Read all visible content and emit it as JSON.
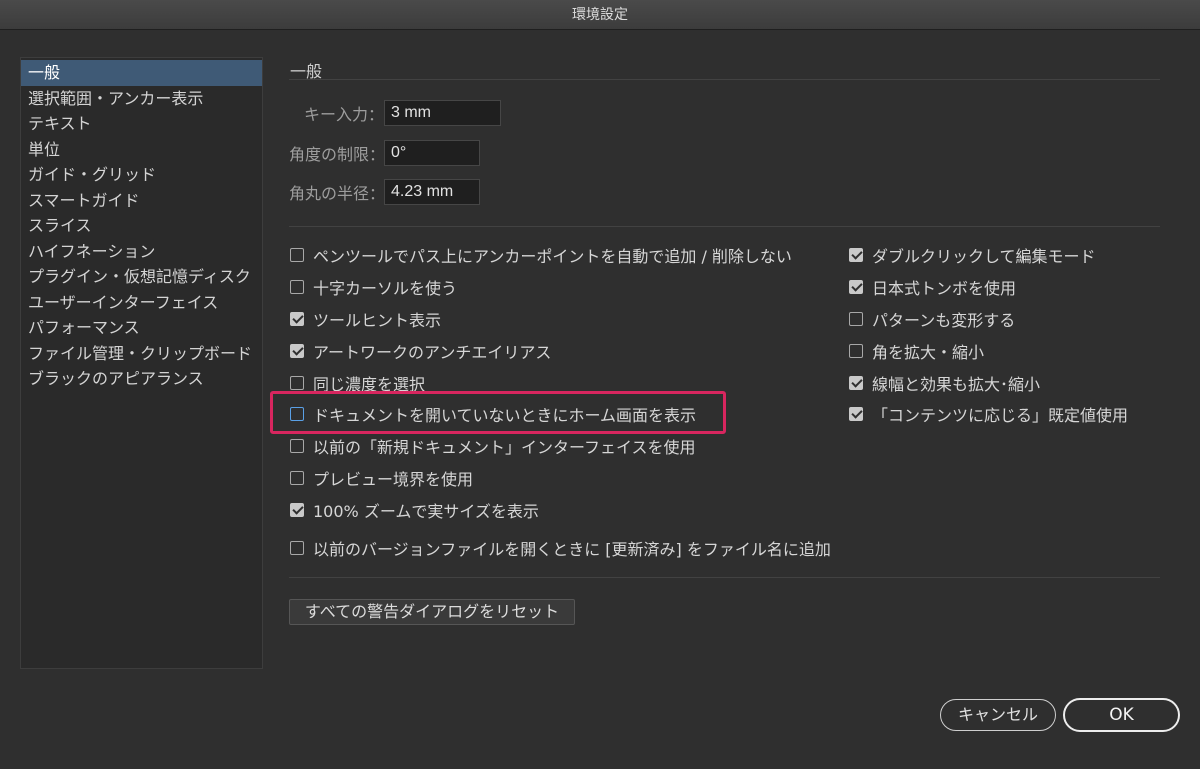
{
  "window": {
    "title": "環境設定"
  },
  "sidebar": {
    "items": [
      {
        "label": "一般"
      },
      {
        "label": "選択範囲・アンカー表示"
      },
      {
        "label": "テキスト"
      },
      {
        "label": "単位"
      },
      {
        "label": "ガイド・グリッド"
      },
      {
        "label": "スマートガイド"
      },
      {
        "label": "スライス"
      },
      {
        "label": "ハイフネーション"
      },
      {
        "label": "プラグイン・仮想記憶ディスク"
      },
      {
        "label": "ユーザーインターフェイス"
      },
      {
        "label": "パフォーマンス"
      },
      {
        "label": "ファイル管理・クリップボード"
      },
      {
        "label": "ブラックのアピアランス"
      }
    ],
    "selected": "一般"
  },
  "main": {
    "section_title": "一般",
    "fields": [
      {
        "label": "キー入力：",
        "value": "3 mm"
      },
      {
        "label": "角度の制限：",
        "value": "0°"
      },
      {
        "label": "角丸の半径：",
        "value": "4.23 mm"
      }
    ],
    "left_options": [
      {
        "label": "ペンツールでパス上にアンカーポイントを自動で追加 / 削除しない",
        "checked": false
      },
      {
        "label": "十字カーソルを使う",
        "checked": false
      },
      {
        "label": "ツールヒント表示",
        "checked": true
      },
      {
        "label": "アートワークのアンチエイリアス",
        "checked": true
      },
      {
        "label": "同じ濃度を選択",
        "checked": false
      },
      {
        "label": "ドキュメントを開いていないときにホーム画面を表示",
        "checked": false
      },
      {
        "label": "以前の「新規ドキュメント」インターフェイスを使用",
        "checked": false
      },
      {
        "label": "プレビュー境界を使用",
        "checked": false
      },
      {
        "label": "100% ズームで実サイズを表示",
        "checked": true
      }
    ],
    "bottom_option": {
      "label": "以前のバージョンファイルを開くときに [更新済み] をファイル名に追加",
      "checked": false
    },
    "right_options": [
      {
        "label": "ダブルクリックして編集モード",
        "checked": true
      },
      {
        "label": "日本式トンボを使用",
        "checked": true
      },
      {
        "label": "パターンも変形する",
        "checked": false
      },
      {
        "label": "角を拡大・縮小",
        "checked": false
      },
      {
        "label": "線幅と効果も拡大･縮小",
        "checked": true
      },
      {
        "label": "「コンテンツに応じる」既定値使用",
        "checked": true
      }
    ],
    "reset_button": "すべての警告ダイアログをリセット"
  },
  "footer": {
    "cancel_label": "キャンセル",
    "ok_label": "OK"
  },
  "colors": {
    "accent_highlight": "#d8265f",
    "selection": "#3f5a76",
    "background": "#2f2f2f"
  }
}
